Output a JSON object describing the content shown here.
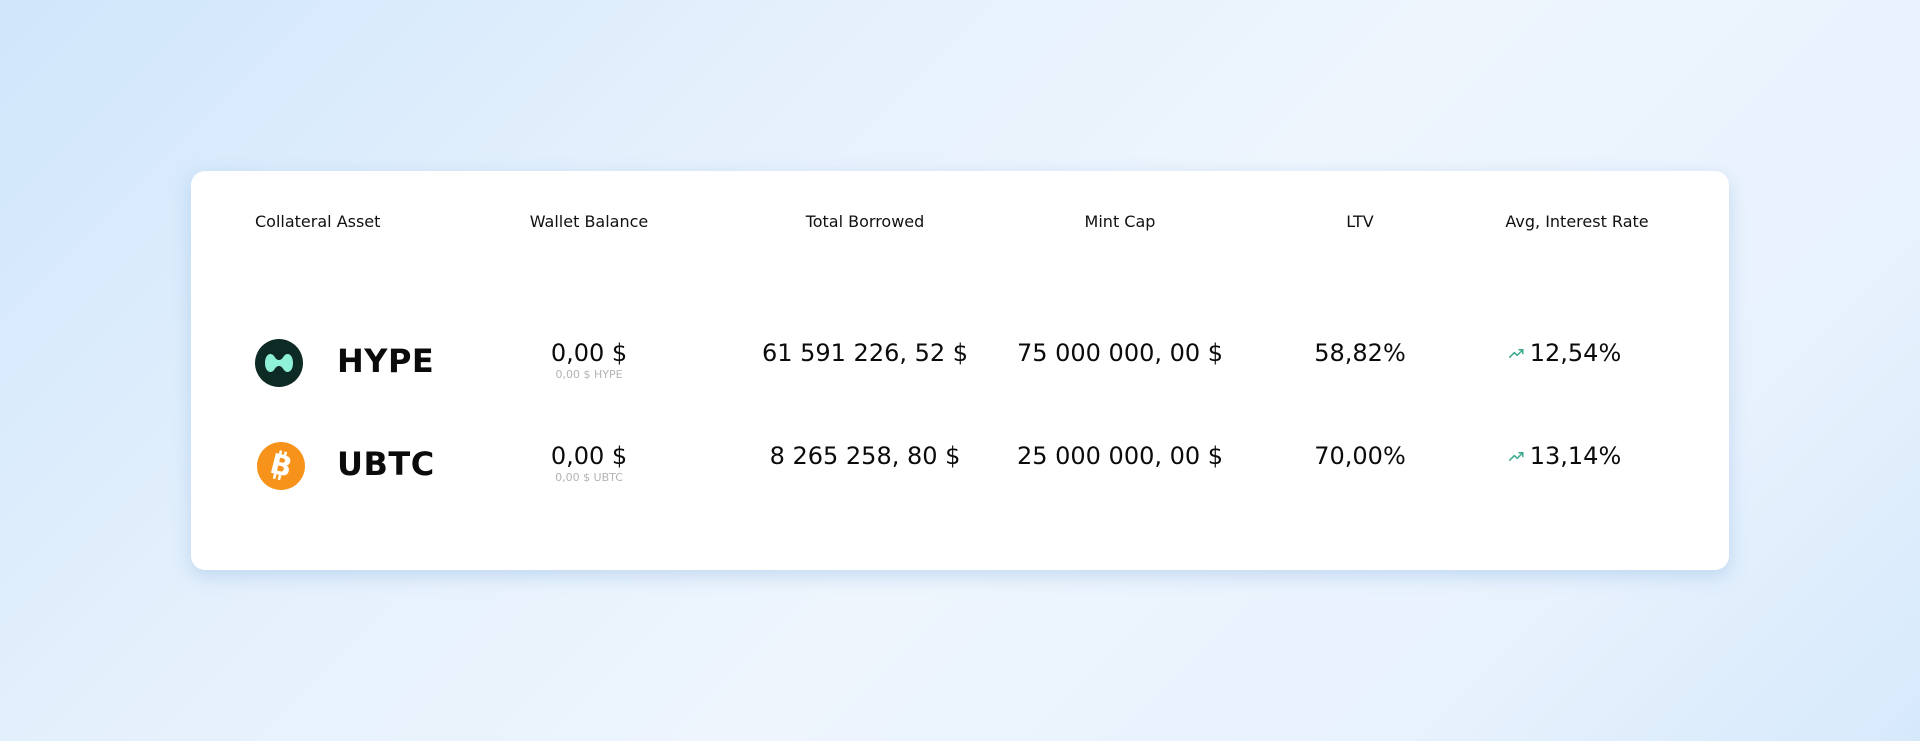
{
  "table": {
    "headers": {
      "asset": "Collateral Asset",
      "wallet": "Wallet Balance",
      "borrowed": "Total Borrowed",
      "mint_cap": "Mint Cap",
      "ltv": "LTV",
      "rate": "Avg, Interest Rate"
    },
    "rows": [
      {
        "symbol": "HYPE",
        "icon": "hype-logo-icon",
        "wallet_value": "0,00 $",
        "wallet_sub": "0,00 $ HYPE",
        "borrowed": "61 591 226, 52 $",
        "mint_cap": "75 000 000, 00 $",
        "ltv": "58,82%",
        "rate": "12,54%"
      },
      {
        "symbol": "UBTC",
        "icon": "bitcoin-logo-icon",
        "wallet_value": "0,00 $",
        "wallet_sub": "0,00 $ UBTC",
        "borrowed": "8 265 258, 80 $",
        "mint_cap": "25 000 000, 00 $",
        "ltv": "70,00%",
        "rate": "13,14%"
      }
    ]
  },
  "colors": {
    "hype_bg": "#0d2a24",
    "hype_mark": "#8ff2d8",
    "btc_bg": "#f7931a",
    "trend": "#3aa88a"
  }
}
